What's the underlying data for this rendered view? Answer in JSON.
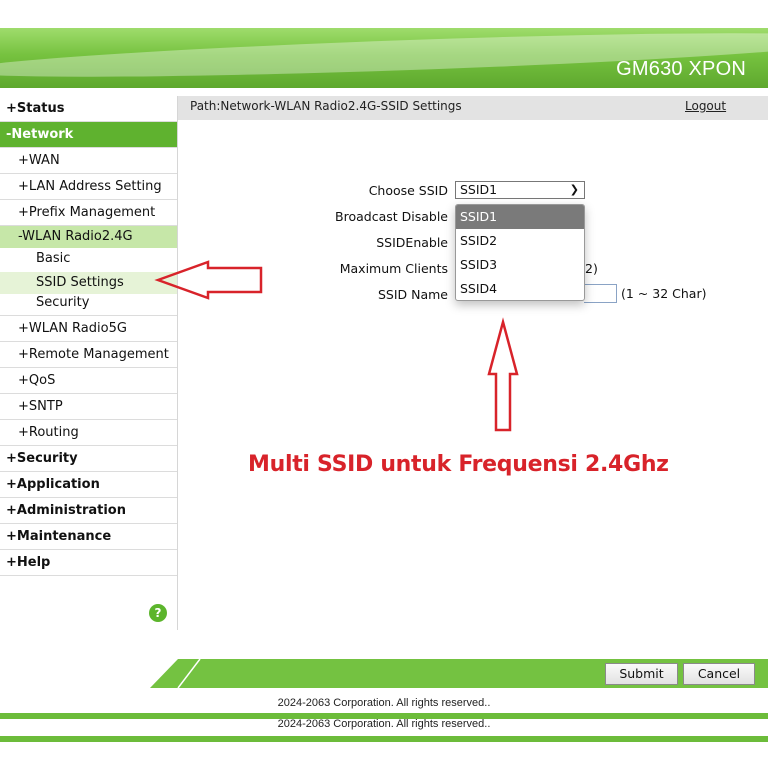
{
  "header": {
    "title": "GM630 XPON"
  },
  "sidebar": {
    "items": [
      {
        "label": "Status",
        "prefix": "+"
      },
      {
        "label": "Network",
        "prefix": "-"
      },
      {
        "label": "WAN",
        "prefix": "+"
      },
      {
        "label": "LAN Address Setting",
        "prefix": "+"
      },
      {
        "label": "Prefix Management",
        "prefix": "+"
      },
      {
        "label": "WLAN Radio2.4G",
        "prefix": "-"
      },
      {
        "label": "Basic"
      },
      {
        "label": "SSID Settings"
      },
      {
        "label": "Security"
      },
      {
        "label": "WLAN Radio5G",
        "prefix": "+"
      },
      {
        "label": "Remote Management",
        "prefix": "+"
      },
      {
        "label": "QoS",
        "prefix": "+"
      },
      {
        "label": "SNTP",
        "prefix": "+"
      },
      {
        "label": "Routing",
        "prefix": "+"
      },
      {
        "label": "Security",
        "prefix": "+"
      },
      {
        "label": "Application",
        "prefix": "+"
      },
      {
        "label": "Administration",
        "prefix": "+"
      },
      {
        "label": "Maintenance",
        "prefix": "+"
      },
      {
        "label": "Help",
        "prefix": "+"
      }
    ],
    "help_icon": "?"
  },
  "pathbar": {
    "path": "Path:Network-WLAN Radio2.4G-SSID Settings",
    "logout": "Logout"
  },
  "form": {
    "choose_ssid_label": "Choose SSID",
    "choose_ssid_value": "SSID1",
    "broadcast_disable_label": "Broadcast Disable",
    "ssid_enable_label": "SSIDEnable",
    "max_clients_label": "Maximum Clients",
    "max_clients_hint_tail": "2)",
    "ssid_name_label": "SSID Name",
    "ssid_name_hint": "(1 ~ 32 Char)",
    "dropdown_options": [
      "SSID1",
      "SSID2",
      "SSID3",
      "SSID4"
    ]
  },
  "annotation": {
    "text": "Multi SSID untuk Frequensi 2.4Ghz",
    "color": "#d8232a"
  },
  "footer": {
    "submit": "Submit",
    "cancel": "Cancel",
    "copyright": "2024-2063 Corporation. All rights reserved..",
    "copyright_repeat": "2024-2063 Corporation. All rights reserved.."
  },
  "colors": {
    "brand_green": "#5fb22f",
    "annotation_red": "#d8232a"
  }
}
